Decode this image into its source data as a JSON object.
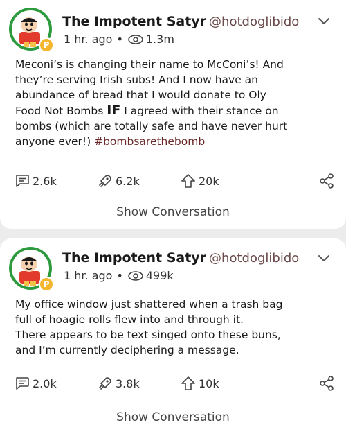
{
  "posts": [
    {
      "author": {
        "display_name": "The Impotent Satyr",
        "handle": "@hotdoglibido",
        "badge_letter": "P"
      },
      "time": "1 hr. ago",
      "separator": "•",
      "views": "1.3m",
      "body_lines": [
        "Meconi’s is changing their name to McConi’s! And",
        "they’re serving Irish subs! And I now have an",
        "abundance of bread that I would donate to Oly",
        "Food Not Bombs",
        "IF",
        "I agreed with their stance on",
        "bombs (which are totally safe and have never hurt",
        "anyone ever!)",
        "#bombsarethebomb"
      ],
      "stats": {
        "comments": "2.6k",
        "reposts": "6.2k",
        "likes": "20k"
      },
      "show_conversation": "Show Conversation"
    },
    {
      "author": {
        "display_name": "The Impotent Satyr",
        "handle": "@hotdoglibido",
        "badge_letter": "P"
      },
      "time": "1 hr. ago",
      "separator": "•",
      "views": "499k",
      "body_lines": [
        "My office window just shattered when a trash bag",
        "full of hoagie rolls flew into and through it.",
        "There appears to be text singed onto these buns,",
        "and I’m currently deciphering a message."
      ],
      "stats": {
        "comments": "2.0k",
        "reposts": "3.8k",
        "likes": "10k"
      },
      "show_conversation": "Show Conversation"
    }
  ],
  "colors": {
    "handle": "#6a4a4a",
    "hashtag": "#6b2a2a",
    "badge": "#f3b62e",
    "avatar_bg": "#e23b2e",
    "avatar_ring": "#2e9a3e"
  },
  "icons": {
    "comment": "speech-bubble-icon",
    "repost": "rocket-icon",
    "like": "up-arrow-icon",
    "share": "share-icon",
    "views": "eye-icon",
    "menu": "chevron-down-icon"
  }
}
